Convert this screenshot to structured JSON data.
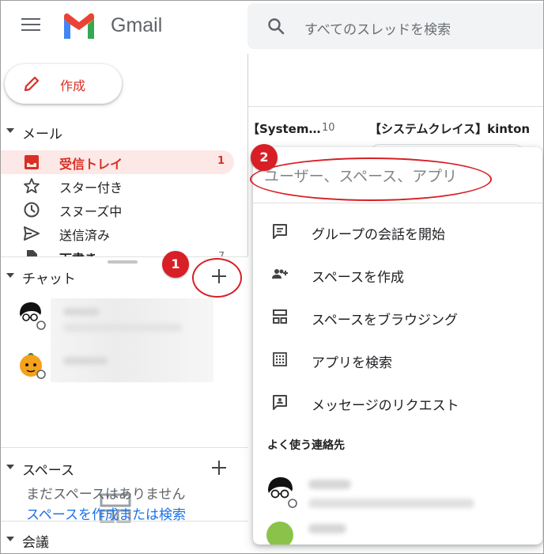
{
  "header": {
    "app_name": "Gmail",
    "search_placeholder": "すべてのスレッドを検索"
  },
  "sidebar": {
    "compose_label": "作成",
    "mail_section": "メール",
    "items": [
      {
        "label": "受信トレイ",
        "icon": "inbox-icon",
        "count": "1"
      },
      {
        "label": "スター付き",
        "icon": "star-icon"
      },
      {
        "label": "スヌーズ中",
        "icon": "clock-icon"
      },
      {
        "label": "送信済み",
        "icon": "send-icon"
      },
      {
        "label": "下書き",
        "icon": "draft-icon",
        "count": "7"
      }
    ],
    "chat_section": "チャット",
    "spaces_section": "スペース",
    "spaces_empty": "まだスペースはありません",
    "spaces_link": "スペースを作成または検索",
    "meet_section": "会議"
  },
  "background_mail": {
    "row1_sender": "【System…",
    "row1_count": "10",
    "row1_subject": "【システムクレイス】kinton"
  },
  "popup": {
    "search_placeholder": "ユーザー、スペース、アプリ",
    "menu": [
      {
        "label": "グループの会話を開始",
        "icon": "chat-bubble-icon"
      },
      {
        "label": "スペースを作成",
        "icon": "group-add-icon"
      },
      {
        "label": "スペースをブラウジング",
        "icon": "browse-spaces-icon"
      },
      {
        "label": "アプリを検索",
        "icon": "apps-grid-icon"
      },
      {
        "label": "メッセージのリクエスト",
        "icon": "message-request-icon"
      }
    ],
    "frequent_contacts_heading": "よく使う連絡先"
  },
  "annotations": {
    "step1": "1",
    "step2": "2",
    "accent_color": "#d81f26"
  }
}
